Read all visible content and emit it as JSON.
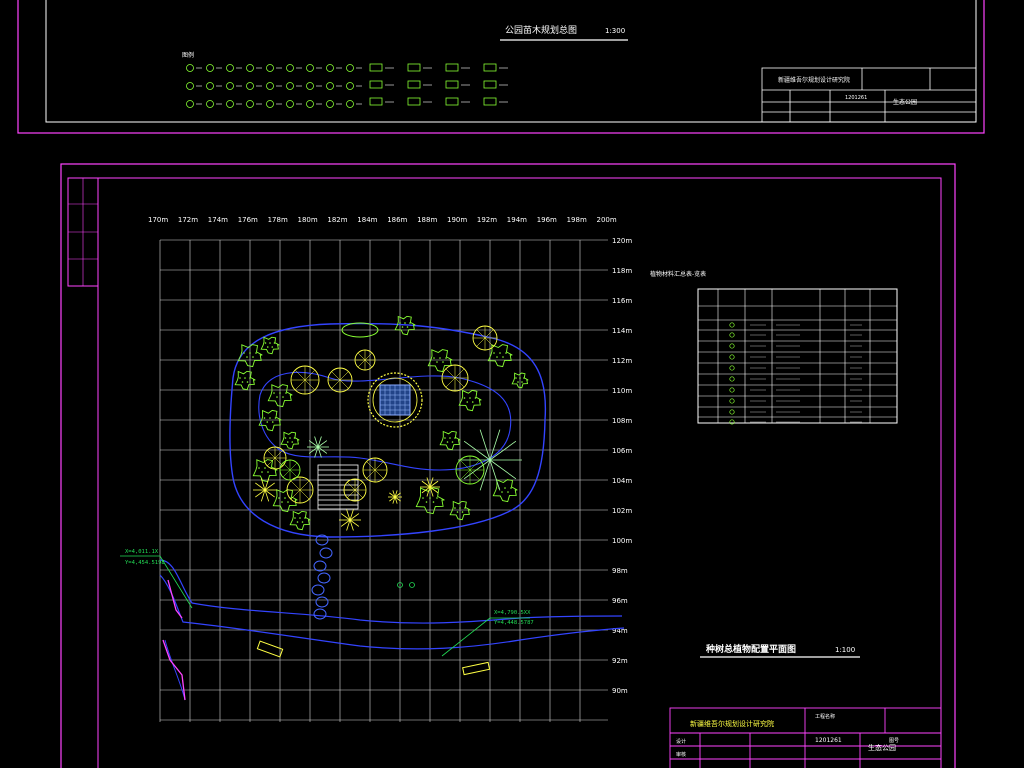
{
  "upper_sheet": {
    "title": "公园苗木规划总图",
    "scale": "1:300",
    "legend_heading": "图例"
  },
  "plan": {
    "title": "种树总植物配置平面图",
    "scale": "1:100",
    "x_ticks": [
      "170m",
      "172m",
      "174m",
      "176m",
      "178m",
      "180m",
      "182m",
      "184m",
      "186m",
      "188m",
      "190m",
      "192m",
      "194m",
      "196m",
      "198m",
      "200m"
    ],
    "y_ticks": [
      "120m",
      "118m",
      "116m",
      "114m",
      "112m",
      "110m",
      "108m",
      "106m",
      "104m",
      "102m",
      "100m",
      "98m",
      "96m",
      "94m",
      "92m",
      "90m"
    ],
    "coord_label_left_1": "X=4,011.1X",
    "coord_label_left_2": "Y=4,454.5198",
    "coord_label_right_1": "X=4,790.5XX",
    "coord_label_right_2": "Y=4,448.5787",
    "table_title": "植物材料汇总表-览表"
  },
  "title_block": {
    "org": "新疆维吾尔规划设计研究院",
    "project": "生态公园",
    "code": "1201261",
    "fields": [
      "工程名称",
      "设计",
      "审核",
      "图号"
    ]
  },
  "colors": {
    "magenta": "#ff44ff",
    "grid": "#e8e8e8",
    "blue": "#3344ff",
    "green": "#88ff33",
    "yellow": "#ffff44",
    "cyan": "#22dddd"
  }
}
